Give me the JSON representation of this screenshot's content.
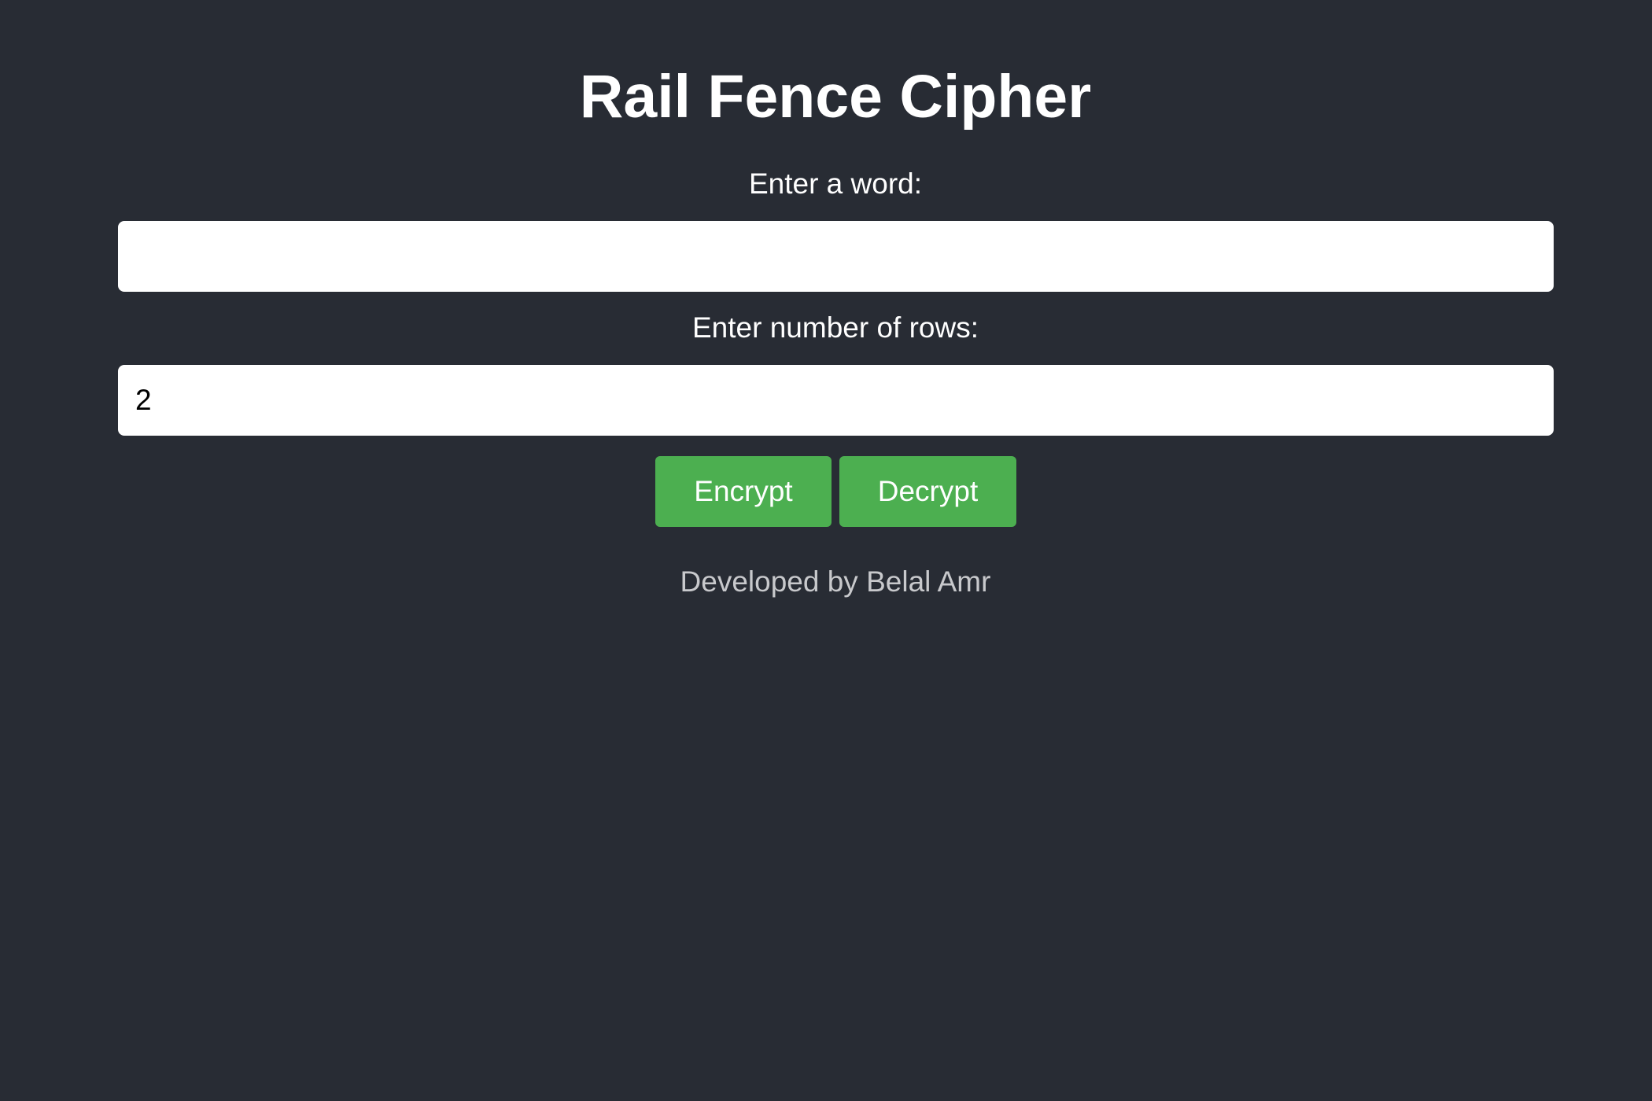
{
  "header": {
    "title": "Rail Fence Cipher"
  },
  "form": {
    "word_label": "Enter a word:",
    "word_value": "",
    "rows_label": "Enter number of rows:",
    "rows_value": "2"
  },
  "actions": {
    "encrypt_label": "Encrypt",
    "decrypt_label": "Decrypt"
  },
  "footer": {
    "credit": "Developed by Belal Amr"
  },
  "colors": {
    "background": "#282c34",
    "button": "#4caf50",
    "text": "#ffffff",
    "credit_text": "#c8c9cc"
  }
}
